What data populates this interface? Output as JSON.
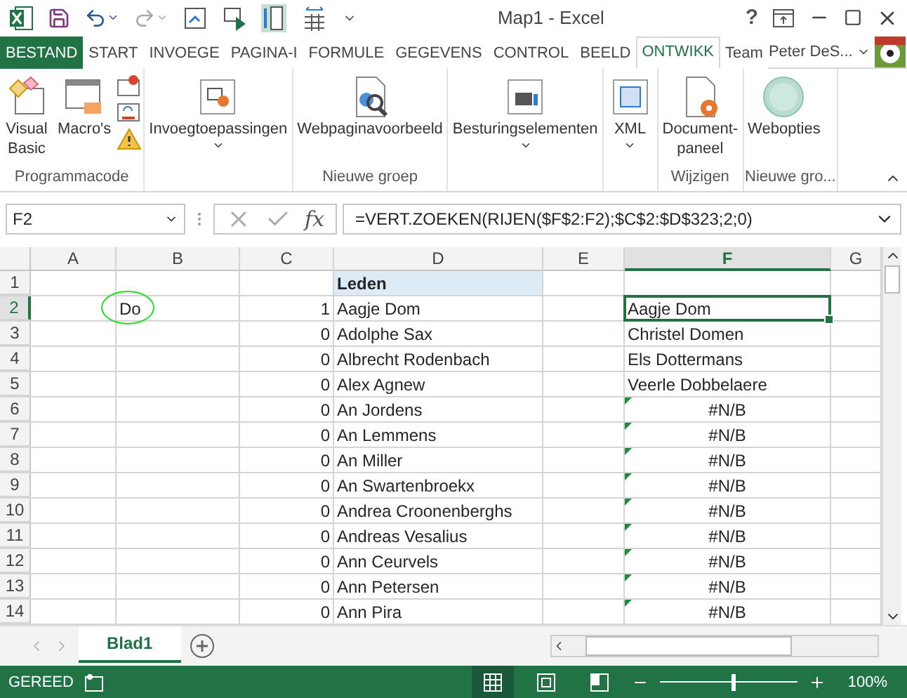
{
  "window": {
    "title": "Map1 - Excel",
    "help": "?"
  },
  "tabs": [
    {
      "label": "BESTAND",
      "kind": "file",
      "selected": false
    },
    {
      "label": "START",
      "kind": "tab",
      "selected": false
    },
    {
      "label": "INVOEGE",
      "kind": "tab",
      "selected": false
    },
    {
      "label": "PAGINA-I",
      "kind": "tab",
      "selected": false
    },
    {
      "label": "FORMULE",
      "kind": "tab",
      "selected": false
    },
    {
      "label": "GEGEVENS",
      "kind": "tab",
      "selected": false
    },
    {
      "label": "CONTROL",
      "kind": "tab",
      "selected": false
    },
    {
      "label": "BEELD",
      "kind": "tab",
      "selected": false
    },
    {
      "label": "ONTWIKK",
      "kind": "tab",
      "selected": true
    },
    {
      "label": "Team",
      "kind": "tab",
      "selected": false
    }
  ],
  "user": {
    "name": "Peter DeS..."
  },
  "ribbon": {
    "groups": [
      {
        "label": "Programmacode",
        "buttons": [
          {
            "label": "Visual\nBasic",
            "kind": "vb",
            "dropdown": false
          },
          {
            "label": "Macro's",
            "kind": "macro",
            "dropdown": false
          }
        ]
      },
      {
        "buttons": [
          {
            "label": "Invoegtoepassingen",
            "kind": "addin",
            "dropdown": true
          }
        ]
      },
      {
        "label": "Nieuwe groep",
        "buttons": [
          {
            "label": "Webpaginavoorbeeld",
            "kind": "web",
            "dropdown": false
          }
        ]
      },
      {
        "buttons": [
          {
            "label": "Besturingselementen",
            "kind": "toolbox",
            "dropdown": true
          }
        ]
      },
      {
        "buttons": [
          {
            "label": "XML",
            "kind": "xml",
            "dropdown": true
          }
        ]
      },
      {
        "label": "Wijzigen",
        "buttons": [
          {
            "label": "Document-\npaneel",
            "kind": "doc",
            "dropdown": false
          }
        ]
      },
      {
        "label": "Nieuwe gro...",
        "buttons": [
          {
            "label": "Webopties",
            "kind": "globe",
            "dropdown": false
          }
        ]
      }
    ]
  },
  "formula_bar": {
    "name_box": "F2",
    "function_label": "fx",
    "formula": "=VERT.ZOEKEN(RIJEN($F$2:F2);$C$2:$D$323;2;0)"
  },
  "columns": [
    {
      "label": "A",
      "selected": false
    },
    {
      "label": "B",
      "selected": false
    },
    {
      "label": "C",
      "selected": false
    },
    {
      "label": "D",
      "selected": false
    },
    {
      "label": "E",
      "selected": false
    },
    {
      "label": "F",
      "selected": true
    },
    {
      "label": "G",
      "selected": false
    }
  ],
  "rows": [
    {
      "label": "1",
      "selected": false,
      "cells": [
        {},
        {},
        {},
        {
          "text": "Leden",
          "kind": "header"
        },
        {},
        {},
        {}
      ]
    },
    {
      "label": "2",
      "selected": true,
      "cells": [
        {},
        {
          "text": "Do",
          "kind": "text",
          "circled": true
        },
        {
          "text": "1",
          "kind": "number"
        },
        {
          "text": "Aagje Dom",
          "kind": "text"
        },
        {},
        {
          "text": "Aagje Dom",
          "kind": "text",
          "selected": true
        },
        {}
      ]
    },
    {
      "label": "3",
      "selected": false,
      "cells": [
        {},
        {},
        {
          "text": "0",
          "kind": "number"
        },
        {
          "text": "Adolphe Sax",
          "kind": "text"
        },
        {},
        {
          "text": "Christel Domen",
          "kind": "text"
        },
        {}
      ]
    },
    {
      "label": "4",
      "selected": false,
      "cells": [
        {},
        {},
        {
          "text": "0",
          "kind": "number"
        },
        {
          "text": "Albrecht Rodenbach",
          "kind": "text"
        },
        {},
        {
          "text": "Els Dottermans",
          "kind": "text"
        },
        {}
      ]
    },
    {
      "label": "5",
      "selected": false,
      "cells": [
        {},
        {},
        {
          "text": "0",
          "kind": "number"
        },
        {
          "text": "Alex Agnew",
          "kind": "text"
        },
        {},
        {
          "text": "Veerle Dobbelaere",
          "kind": "text"
        },
        {}
      ]
    },
    {
      "label": "6",
      "selected": false,
      "cells": [
        {},
        {},
        {
          "text": "0",
          "kind": "number"
        },
        {
          "text": "An Jordens",
          "kind": "text"
        },
        {},
        {
          "text": "#N/B",
          "kind": "error",
          "error_flag": true
        },
        {}
      ]
    },
    {
      "label": "7",
      "selected": false,
      "cells": [
        {},
        {},
        {
          "text": "0",
          "kind": "number"
        },
        {
          "text": "An Lemmens",
          "kind": "text"
        },
        {},
        {
          "text": "#N/B",
          "kind": "error",
          "error_flag": true
        },
        {}
      ]
    },
    {
      "label": "8",
      "selected": false,
      "cells": [
        {},
        {},
        {
          "text": "0",
          "kind": "number"
        },
        {
          "text": "An Miller",
          "kind": "text"
        },
        {},
        {
          "text": "#N/B",
          "kind": "error",
          "error_flag": true
        },
        {}
      ]
    },
    {
      "label": "9",
      "selected": false,
      "cells": [
        {},
        {},
        {
          "text": "0",
          "kind": "number"
        },
        {
          "text": "An Swartenbroekx",
          "kind": "text"
        },
        {},
        {
          "text": "#N/B",
          "kind": "error",
          "error_flag": true
        },
        {}
      ]
    },
    {
      "label": "10",
      "selected": false,
      "cells": [
        {},
        {},
        {
          "text": "0",
          "kind": "number"
        },
        {
          "text": "Andrea Croonenberghs",
          "kind": "text"
        },
        {},
        {
          "text": "#N/B",
          "kind": "error",
          "error_flag": true
        },
        {}
      ]
    },
    {
      "label": "11",
      "selected": false,
      "cells": [
        {},
        {},
        {
          "text": "0",
          "kind": "number"
        },
        {
          "text": "Andreas Vesalius",
          "kind": "text"
        },
        {},
        {
          "text": "#N/B",
          "kind": "error",
          "error_flag": true
        },
        {}
      ]
    },
    {
      "label": "12",
      "selected": false,
      "cells": [
        {},
        {},
        {
          "text": "0",
          "kind": "number"
        },
        {
          "text": "Ann Ceurvels",
          "kind": "text"
        },
        {},
        {
          "text": "#N/B",
          "kind": "error",
          "error_flag": true
        },
        {}
      ]
    },
    {
      "label": "13",
      "selected": false,
      "cells": [
        {},
        {},
        {
          "text": "0",
          "kind": "number"
        },
        {
          "text": "Ann Petersen",
          "kind": "text"
        },
        {},
        {
          "text": "#N/B",
          "kind": "error",
          "error_flag": true
        },
        {}
      ]
    },
    {
      "label": "14",
      "selected": false,
      "cells": [
        {},
        {},
        {
          "text": "0",
          "kind": "number"
        },
        {
          "text": "Ann Pira",
          "kind": "text"
        },
        {},
        {
          "text": "#N/B",
          "kind": "error",
          "error_flag": true
        },
        {}
      ]
    }
  ],
  "sheets": [
    {
      "label": "Blad1",
      "selected": true
    }
  ],
  "status_bar": {
    "text": "GEREED",
    "views": [
      {
        "kind": "normal",
        "selected": true
      },
      {
        "kind": "layout",
        "selected": false
      },
      {
        "kind": "pagebreak",
        "selected": false
      }
    ],
    "zoom": {
      "level": 0.52,
      "reading": "100%"
    }
  }
}
